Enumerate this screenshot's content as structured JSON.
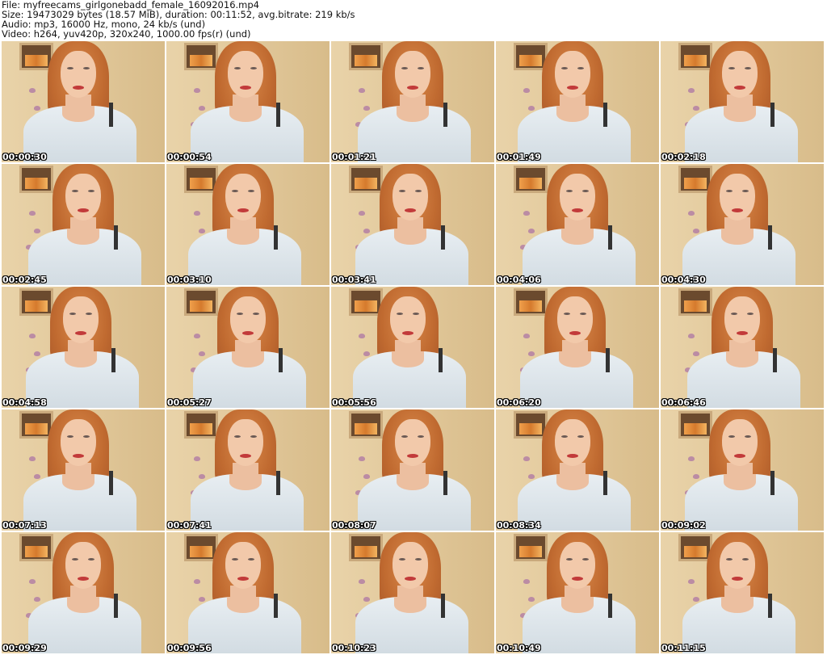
{
  "header": {
    "file": "File: myfreecams_girlgonebadd_female_16092016.mp4",
    "size": "Size: 19473029 bytes (18.57 MiB), duration: 00:11:52, avg.bitrate: 219 kb/s",
    "audio": "Audio: mp3, 16000 Hz, mono, 24 kb/s (und)",
    "video": "Video: h264, yuv420p, 320x240, 1000.00 fps(r) (und)"
  },
  "thumbnails": [
    "00:00:30",
    "00:00:54",
    "00:01:21",
    "00:01:49",
    "00:02:18",
    "00:02:45",
    "00:03:10",
    "00:03:41",
    "00:04:06",
    "00:04:30",
    "00:04:58",
    "00:05:27",
    "00:05:56",
    "00:06:20",
    "00:06:46",
    "00:07:13",
    "00:07:41",
    "00:08:07",
    "00:08:34",
    "00:09:02",
    "00:09:29",
    "00:09:56",
    "00:10:23",
    "00:10:49",
    "00:11:15"
  ]
}
